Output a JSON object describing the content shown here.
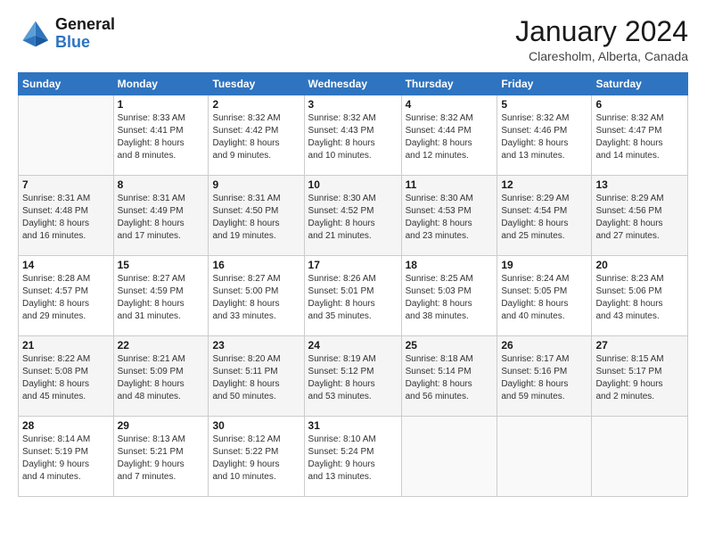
{
  "logo": {
    "line1": "General",
    "line2": "Blue"
  },
  "header": {
    "month": "January 2024",
    "location": "Claresholm, Alberta, Canada"
  },
  "weekdays": [
    "Sunday",
    "Monday",
    "Tuesday",
    "Wednesday",
    "Thursday",
    "Friday",
    "Saturday"
  ],
  "weeks": [
    [
      {
        "day": "",
        "info": ""
      },
      {
        "day": "1",
        "info": "Sunrise: 8:33 AM\nSunset: 4:41 PM\nDaylight: 8 hours\nand 8 minutes."
      },
      {
        "day": "2",
        "info": "Sunrise: 8:32 AM\nSunset: 4:42 PM\nDaylight: 8 hours\nand 9 minutes."
      },
      {
        "day": "3",
        "info": "Sunrise: 8:32 AM\nSunset: 4:43 PM\nDaylight: 8 hours\nand 10 minutes."
      },
      {
        "day": "4",
        "info": "Sunrise: 8:32 AM\nSunset: 4:44 PM\nDaylight: 8 hours\nand 12 minutes."
      },
      {
        "day": "5",
        "info": "Sunrise: 8:32 AM\nSunset: 4:46 PM\nDaylight: 8 hours\nand 13 minutes."
      },
      {
        "day": "6",
        "info": "Sunrise: 8:32 AM\nSunset: 4:47 PM\nDaylight: 8 hours\nand 14 minutes."
      }
    ],
    [
      {
        "day": "7",
        "info": "Sunrise: 8:31 AM\nSunset: 4:48 PM\nDaylight: 8 hours\nand 16 minutes."
      },
      {
        "day": "8",
        "info": "Sunrise: 8:31 AM\nSunset: 4:49 PM\nDaylight: 8 hours\nand 17 minutes."
      },
      {
        "day": "9",
        "info": "Sunrise: 8:31 AM\nSunset: 4:50 PM\nDaylight: 8 hours\nand 19 minutes."
      },
      {
        "day": "10",
        "info": "Sunrise: 8:30 AM\nSunset: 4:52 PM\nDaylight: 8 hours\nand 21 minutes."
      },
      {
        "day": "11",
        "info": "Sunrise: 8:30 AM\nSunset: 4:53 PM\nDaylight: 8 hours\nand 23 minutes."
      },
      {
        "day": "12",
        "info": "Sunrise: 8:29 AM\nSunset: 4:54 PM\nDaylight: 8 hours\nand 25 minutes."
      },
      {
        "day": "13",
        "info": "Sunrise: 8:29 AM\nSunset: 4:56 PM\nDaylight: 8 hours\nand 27 minutes."
      }
    ],
    [
      {
        "day": "14",
        "info": "Sunrise: 8:28 AM\nSunset: 4:57 PM\nDaylight: 8 hours\nand 29 minutes."
      },
      {
        "day": "15",
        "info": "Sunrise: 8:27 AM\nSunset: 4:59 PM\nDaylight: 8 hours\nand 31 minutes."
      },
      {
        "day": "16",
        "info": "Sunrise: 8:27 AM\nSunset: 5:00 PM\nDaylight: 8 hours\nand 33 minutes."
      },
      {
        "day": "17",
        "info": "Sunrise: 8:26 AM\nSunset: 5:01 PM\nDaylight: 8 hours\nand 35 minutes."
      },
      {
        "day": "18",
        "info": "Sunrise: 8:25 AM\nSunset: 5:03 PM\nDaylight: 8 hours\nand 38 minutes."
      },
      {
        "day": "19",
        "info": "Sunrise: 8:24 AM\nSunset: 5:05 PM\nDaylight: 8 hours\nand 40 minutes."
      },
      {
        "day": "20",
        "info": "Sunrise: 8:23 AM\nSunset: 5:06 PM\nDaylight: 8 hours\nand 43 minutes."
      }
    ],
    [
      {
        "day": "21",
        "info": "Sunrise: 8:22 AM\nSunset: 5:08 PM\nDaylight: 8 hours\nand 45 minutes."
      },
      {
        "day": "22",
        "info": "Sunrise: 8:21 AM\nSunset: 5:09 PM\nDaylight: 8 hours\nand 48 minutes."
      },
      {
        "day": "23",
        "info": "Sunrise: 8:20 AM\nSunset: 5:11 PM\nDaylight: 8 hours\nand 50 minutes."
      },
      {
        "day": "24",
        "info": "Sunrise: 8:19 AM\nSunset: 5:12 PM\nDaylight: 8 hours\nand 53 minutes."
      },
      {
        "day": "25",
        "info": "Sunrise: 8:18 AM\nSunset: 5:14 PM\nDaylight: 8 hours\nand 56 minutes."
      },
      {
        "day": "26",
        "info": "Sunrise: 8:17 AM\nSunset: 5:16 PM\nDaylight: 8 hours\nand 59 minutes."
      },
      {
        "day": "27",
        "info": "Sunrise: 8:15 AM\nSunset: 5:17 PM\nDaylight: 9 hours\nand 2 minutes."
      }
    ],
    [
      {
        "day": "28",
        "info": "Sunrise: 8:14 AM\nSunset: 5:19 PM\nDaylight: 9 hours\nand 4 minutes."
      },
      {
        "day": "29",
        "info": "Sunrise: 8:13 AM\nSunset: 5:21 PM\nDaylight: 9 hours\nand 7 minutes."
      },
      {
        "day": "30",
        "info": "Sunrise: 8:12 AM\nSunset: 5:22 PM\nDaylight: 9 hours\nand 10 minutes."
      },
      {
        "day": "31",
        "info": "Sunrise: 8:10 AM\nSunset: 5:24 PM\nDaylight: 9 hours\nand 13 minutes."
      },
      {
        "day": "",
        "info": ""
      },
      {
        "day": "",
        "info": ""
      },
      {
        "day": "",
        "info": ""
      }
    ]
  ]
}
